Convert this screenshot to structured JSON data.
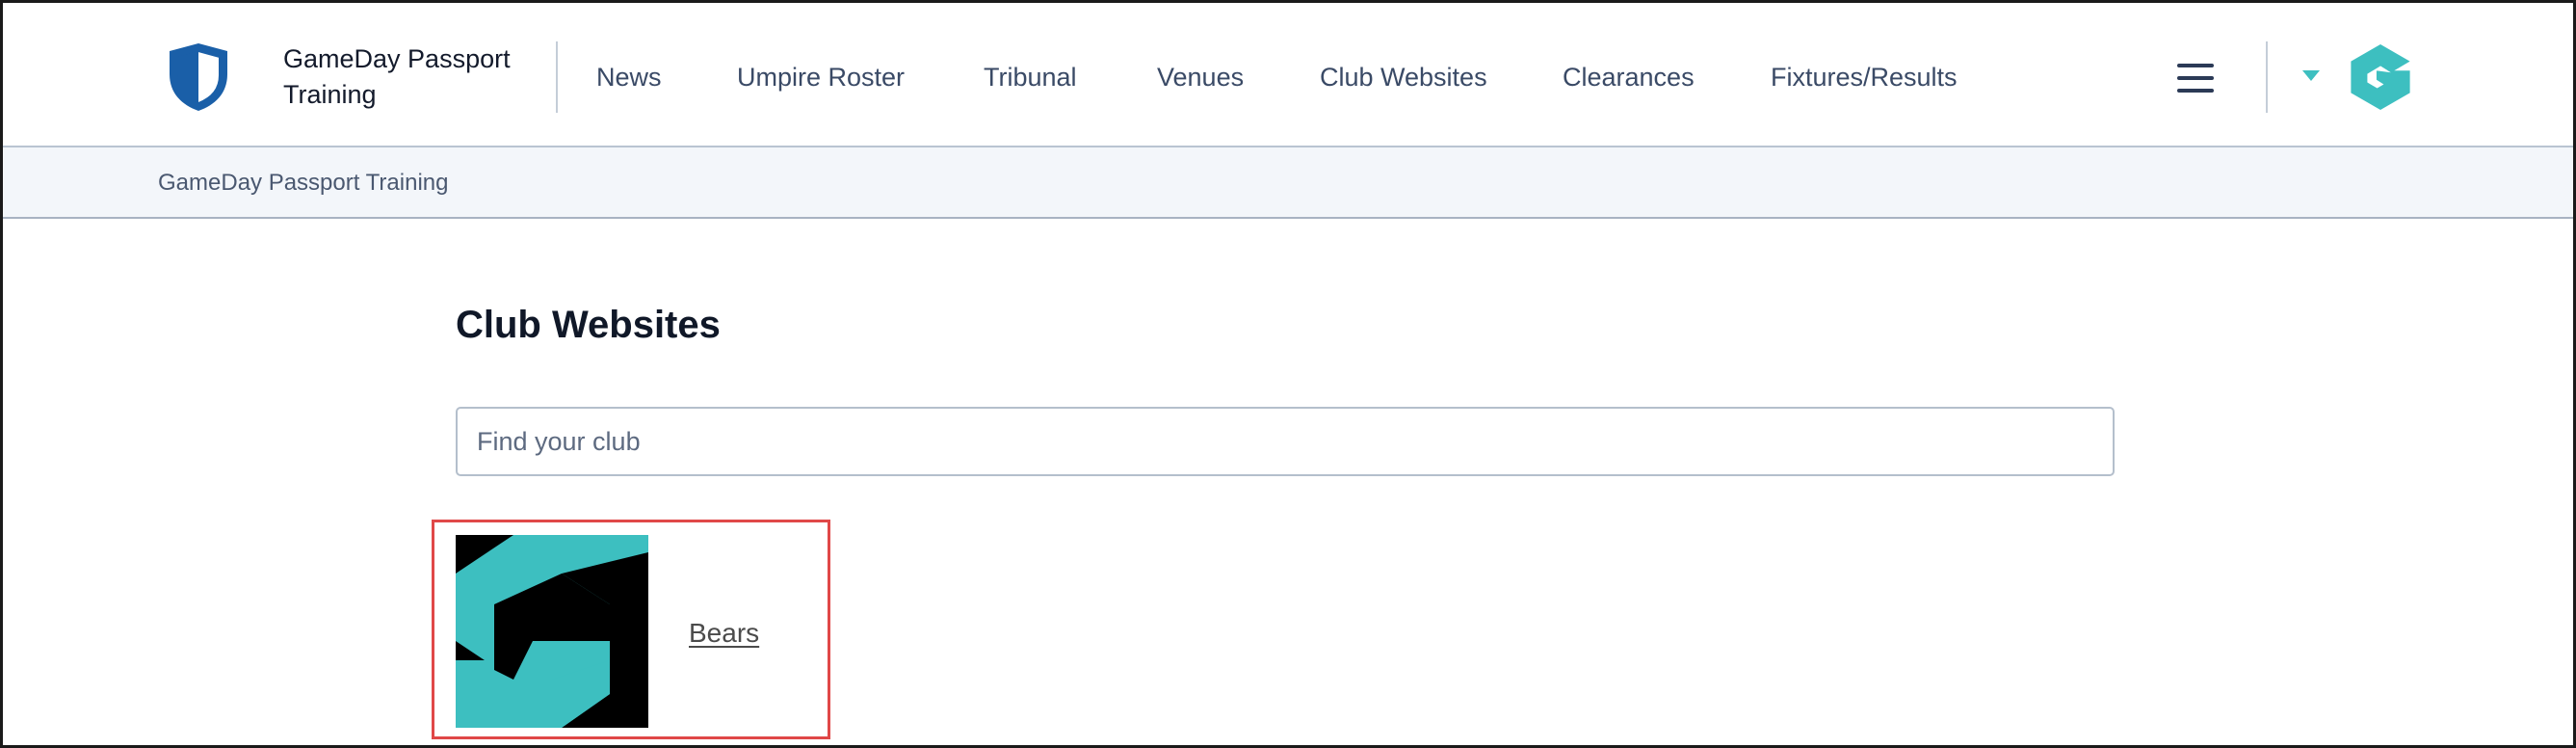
{
  "header": {
    "brand_name": "GameDay Passport Training",
    "nav": [
      {
        "label": "News"
      },
      {
        "label": "Umpire Roster"
      },
      {
        "label": "Tribunal"
      },
      {
        "label": "Venues"
      },
      {
        "label": "Club Websites"
      },
      {
        "label": "Clearances"
      },
      {
        "label": "Fixtures/Results"
      }
    ],
    "icons": {
      "logo": "shield-icon",
      "menu": "hamburger-menu-icon",
      "dropdown": "caret-down-icon",
      "brand_mark": "gameday-g-logo-icon"
    }
  },
  "breadcrumb": {
    "items": [
      "GameDay Passport Training"
    ]
  },
  "main": {
    "title": "Club Websites",
    "search": {
      "placeholder": "Find your club",
      "value": ""
    },
    "clubs": [
      {
        "name": "Bears",
        "logo_icon": "gameday-g-logo-icon"
      }
    ]
  },
  "colors": {
    "accent_teal": "#3dbfc0",
    "shield_blue": "#1a5fa8",
    "nav_text": "#3a4a66",
    "breadcrumb_bg": "#f3f6fa",
    "highlight_border": "#e04848"
  }
}
